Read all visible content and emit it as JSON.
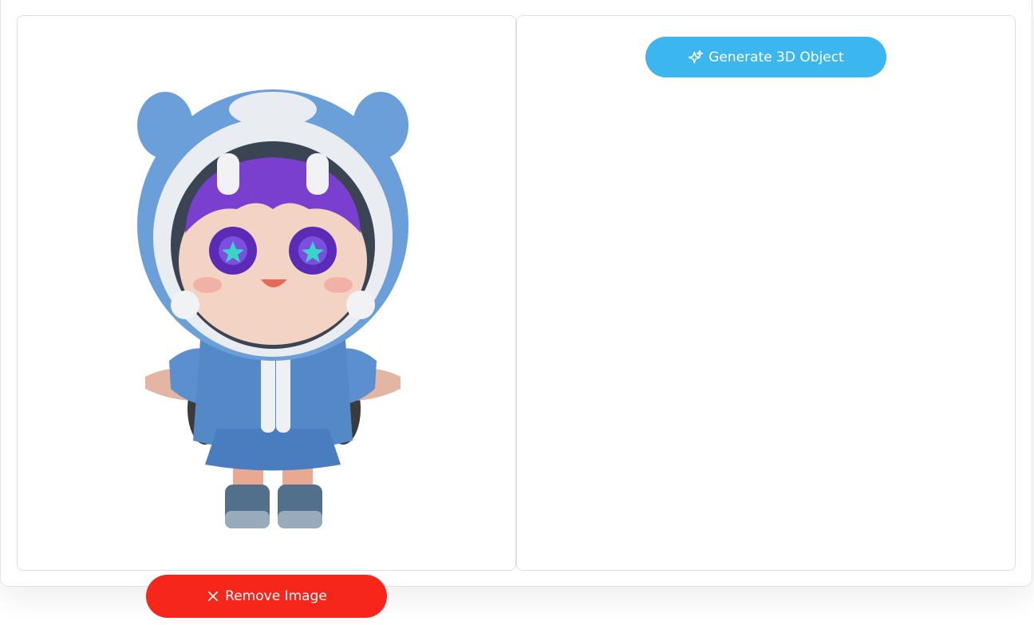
{
  "buttons": {
    "generate_label": "Generate 3D Object",
    "remove_label": "Remove Image"
  },
  "icons": {
    "generate_icon": "sparkles-icon",
    "remove_icon": "close-icon"
  },
  "colors": {
    "generate_bg": "#3cb6ee",
    "remove_bg": "#f7261a"
  }
}
